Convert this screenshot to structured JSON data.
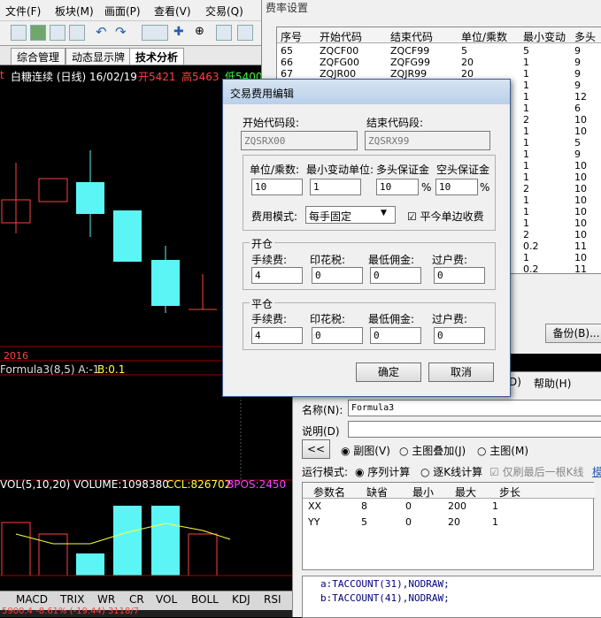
{
  "menu": [
    "文件(F)",
    "板块(M)",
    "画面(P)",
    "查看(V)",
    "交易(Q)"
  ],
  "tabs": [
    "综合管理",
    "动态显示牌",
    "技术分析"
  ],
  "chart": {
    "caption_name": "白糖连续 (日线) 16/02/19",
    "caption_open": "开5421",
    "caption_high": "高5463",
    "caption_low": "低5400",
    "year_label": "2016",
    "formula_line_a": "Formula3(8,5) A:-1",
    "formula_line_b": "B:0.1",
    "vol_caption": "VOL(5,10,20) VOLUME:1098380",
    "vol_ccl": "CCL:826702",
    "vol_bpos": "BPOS:2450",
    "status_text": "5900.4  -8.61% (-19.44)  3118/7"
  },
  "indicator_tabs": [
    "MACD",
    "TRIX",
    "WR",
    "CR",
    "VOL",
    "BOLL",
    "KDJ",
    "RSI"
  ],
  "rate_window": {
    "title": "费率设置",
    "columns": [
      "序号",
      "开始代码",
      "结束代码",
      "单位/乘数",
      "最小变动",
      "多头"
    ],
    "rows": [
      [
        "65",
        "ZQCF00",
        "ZQCF99",
        "5",
        "5",
        "9"
      ],
      [
        "66",
        "ZQFG00",
        "ZQFG99",
        "20",
        "1",
        "9"
      ],
      [
        "67",
        "ZQJR00",
        "ZQJR99",
        "20",
        "1",
        "9"
      ],
      [
        "",
        "",
        "",
        "",
        "1",
        "9"
      ],
      [
        "",
        "",
        "",
        "",
        "1",
        "12"
      ],
      [
        "",
        "",
        "",
        "",
        "1",
        "6"
      ],
      [
        "",
        "",
        "",
        "",
        "2",
        "10"
      ],
      [
        "",
        "",
        "",
        "",
        "1",
        "10"
      ],
      [
        "",
        "",
        "",
        "",
        "1",
        "5"
      ],
      [
        "",
        "",
        "",
        "",
        "1",
        "9"
      ],
      [
        "",
        "",
        "",
        "",
        "1",
        "10"
      ],
      [
        "",
        "",
        "",
        "",
        "1",
        "10"
      ],
      [
        "",
        "",
        "",
        "",
        "2",
        "10"
      ],
      [
        "",
        "",
        "",
        "",
        "1",
        "10"
      ],
      [
        "",
        "",
        "",
        "",
        "1",
        "10"
      ],
      [
        "",
        "",
        "",
        "",
        "1",
        "10"
      ],
      [
        "",
        "",
        "",
        "",
        "2",
        "10"
      ],
      [
        "",
        "",
        "",
        "",
        "0.2",
        "11"
      ],
      [
        "",
        "",
        "",
        "",
        "1",
        "10"
      ],
      [
        "",
        "",
        "",
        "",
        "0.2",
        "11"
      ]
    ],
    "backup_button": "备份(B)..."
  },
  "dialog": {
    "title": "交易费用编辑",
    "start_code_label": "开始代码段:",
    "end_code_label": "结束代码段:",
    "start_code_value": "ZQSRX00",
    "end_code_value": "ZQSRX99",
    "unit_label": "单位/乘数:",
    "min_change_label": "最小变动单位:",
    "long_margin_label": "多头保证金",
    "short_margin_label": "空头保证金",
    "unit_value": "10",
    "min_change_value": "1",
    "long_margin_value": "10",
    "short_margin_value": "10",
    "percent": "%",
    "fee_mode_label": "费用模式:",
    "fee_mode_value": "每手固定",
    "close_today_label": "平今单边收费",
    "open_group": "开仓",
    "close_group": "平仓",
    "fee_label": "手续费:",
    "stamp_label": "印花税:",
    "min_commission_label": "最低佣金:",
    "transfer_label": "过户费:",
    "open_values": [
      "4",
      "0",
      "0",
      "0"
    ],
    "close_values": [
      "4",
      "0",
      "0",
      "0"
    ],
    "ok_button": "确定",
    "cancel_button": "取消"
  },
  "formula_window": {
    "menu_d": "D)",
    "menu_help": "帮助(H)",
    "name_label": "名称(N):",
    "name_value": "Formula3",
    "desc_label": "说明(D)",
    "back_button": "<<",
    "radio_sub": "副图(V)",
    "radio_main_overlay": "主图叠加(J)",
    "radio_main": "主图(M)",
    "run_mode_label": "运行模式:",
    "radio_seq": "序列计算",
    "radio_kline": "逐K线计算",
    "check_last": "仅刷最后一根K线",
    "more_link": "模",
    "param_columns": [
      "参数名",
      "缺省",
      "最小",
      "最大",
      "步长"
    ],
    "params": [
      [
        "XX",
        "8",
        "0",
        "200",
        "1"
      ],
      [
        "YY",
        "5",
        "0",
        "20",
        "1"
      ]
    ],
    "code_lines": [
      "a:TACCOUNT(31),NODRAW;",
      "b:TACCOUNT(41),NODRAW;"
    ]
  }
}
